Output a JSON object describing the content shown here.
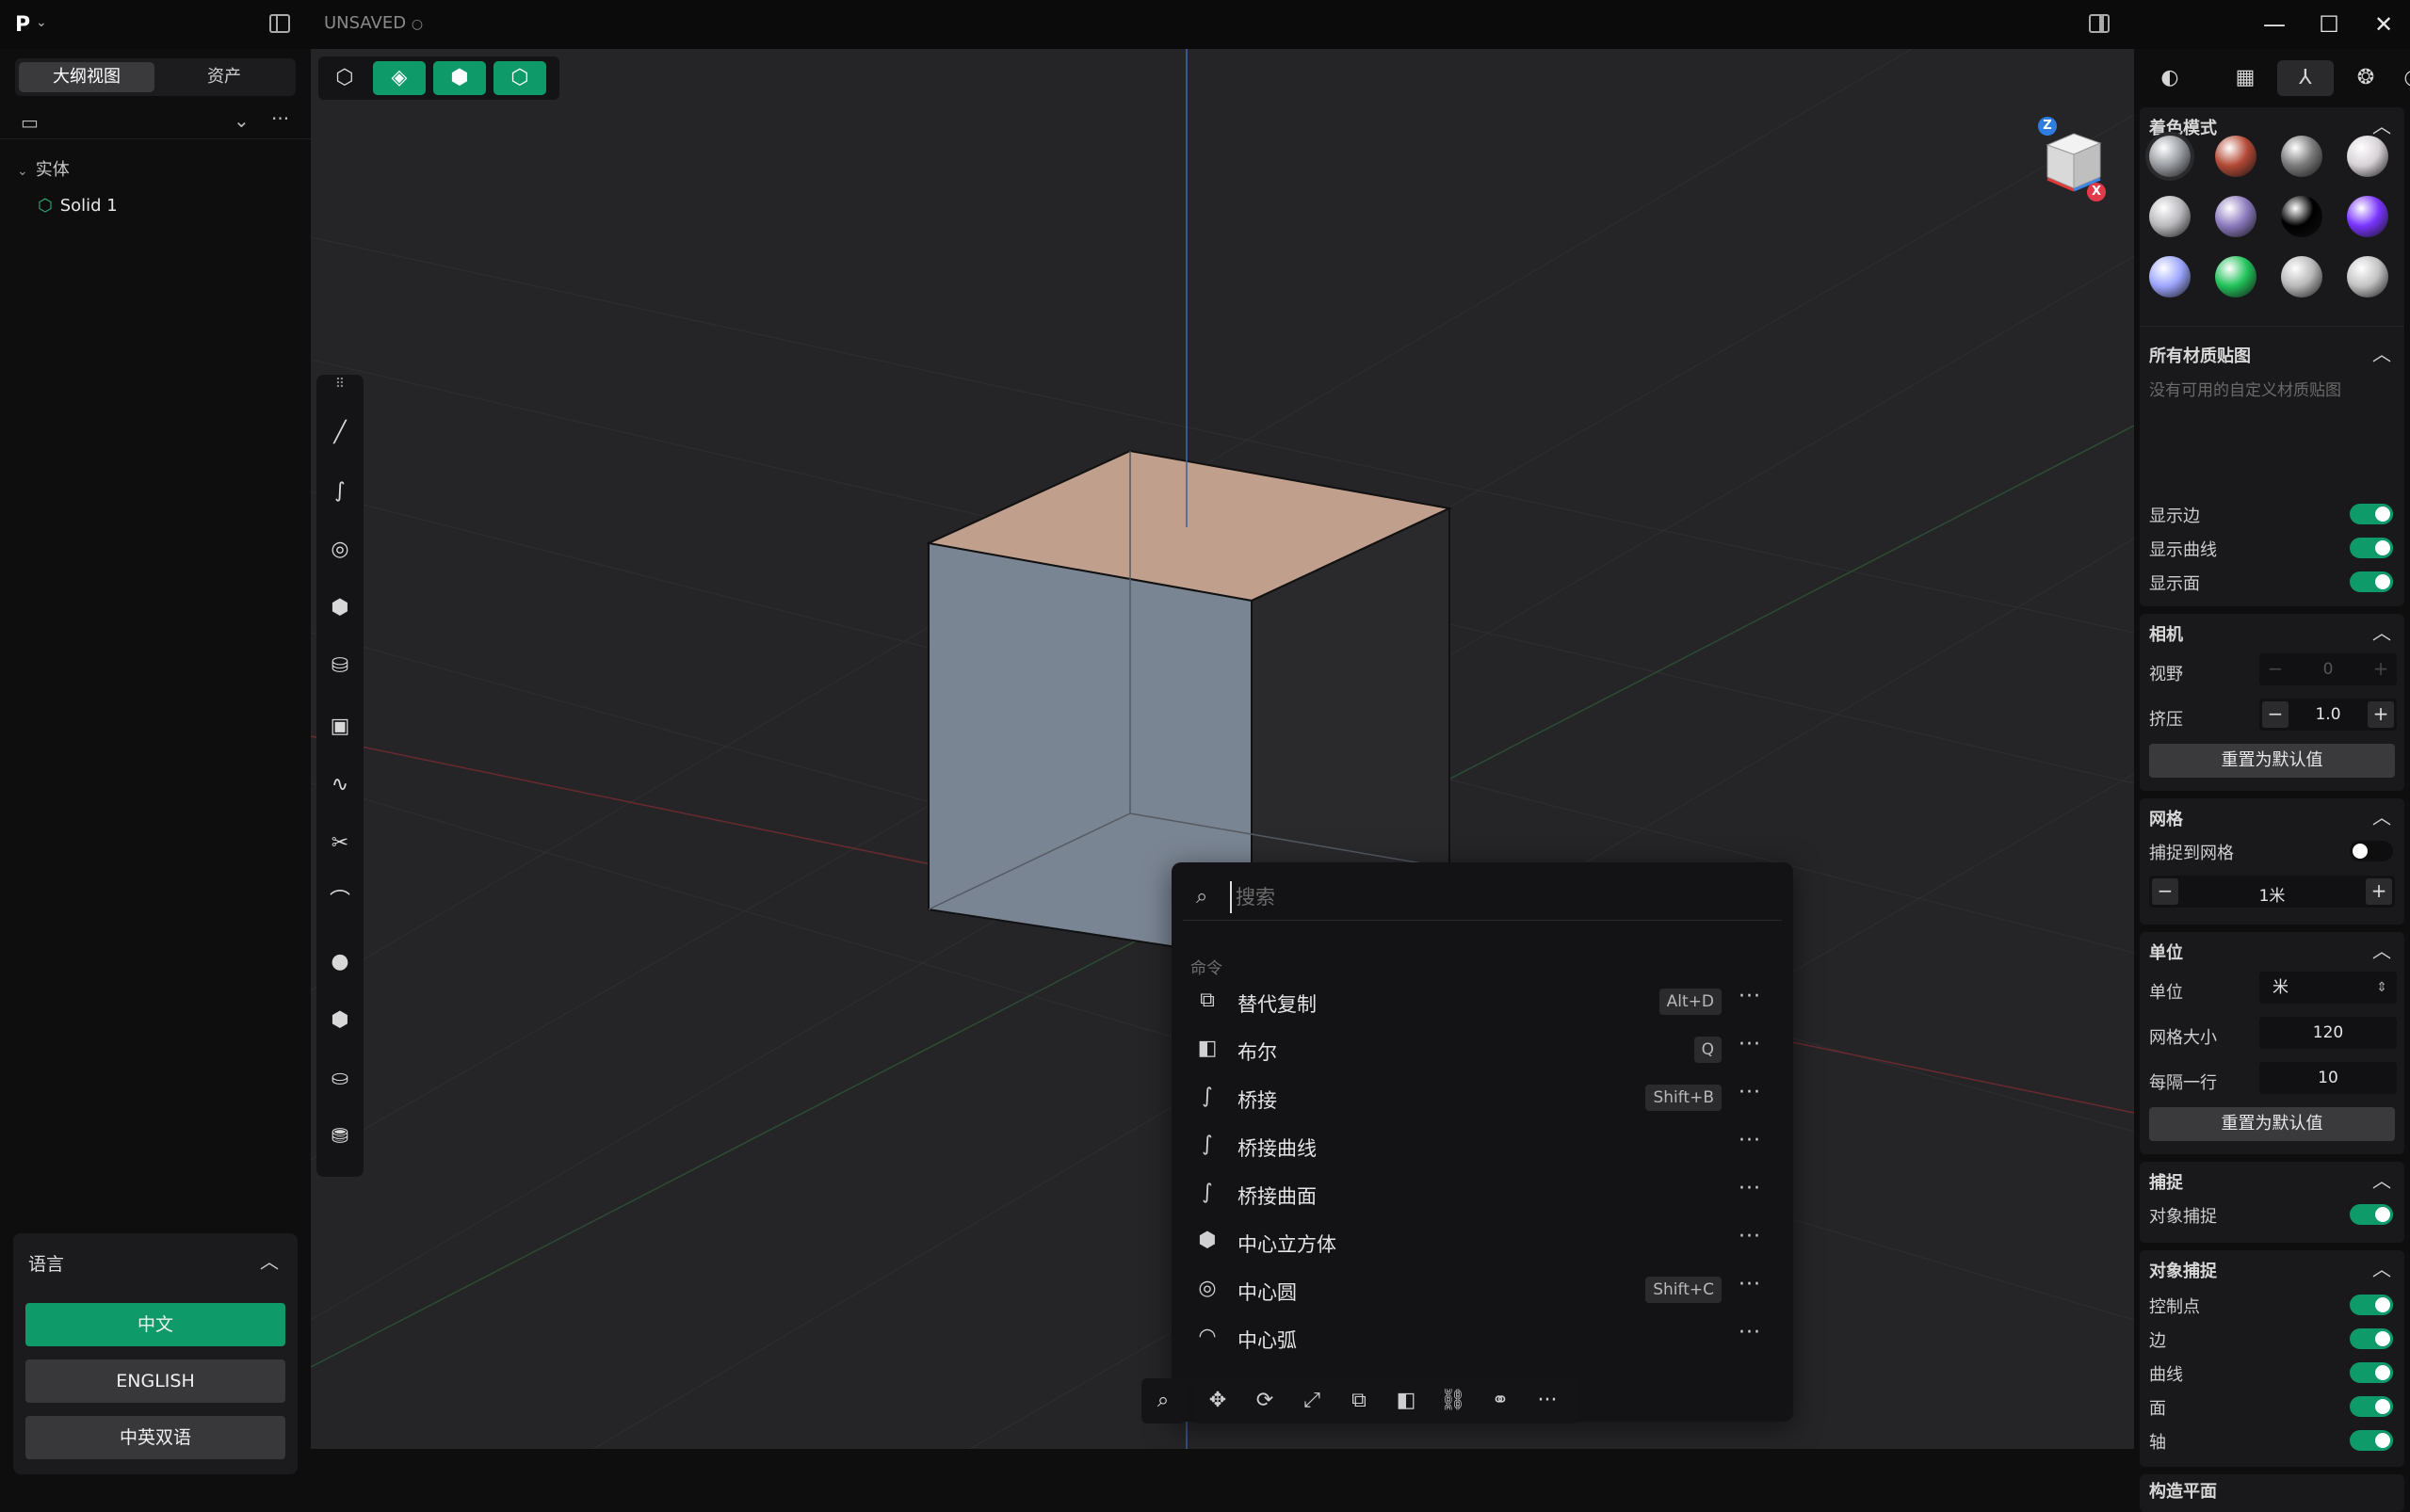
{
  "titlebar": {
    "logo": "P",
    "status": "UNSAVED",
    "window_controls": [
      "minimize",
      "maximize",
      "close"
    ]
  },
  "left_panel": {
    "tabs": [
      "大纲视图",
      "资产"
    ],
    "tree_group": "实体",
    "tree_item": "Solid 1",
    "language": {
      "title": "语言",
      "options": [
        "中文",
        "ENGLISH",
        "中英双语"
      ],
      "selected": "中文"
    }
  },
  "viewport": {
    "toolbar_icons": [
      "select-mode-icon",
      "vertex-mode-icon",
      "face-mode-icon",
      "object-mode-icon"
    ],
    "side_tools": [
      "line-icon",
      "curve-icon",
      "circle-icon",
      "polygon-icon",
      "extrude-icon",
      "rectangle-icon",
      "spline-icon",
      "scissors-icon",
      "fillet-icon",
      "sphere-icon",
      "box-icon",
      "cylinder-icon",
      "loft-icon"
    ],
    "viewcube_axes": {
      "z": "Z",
      "x": "X"
    }
  },
  "palette": {
    "search_placeholder": "搜索",
    "section": "命令",
    "commands": [
      {
        "label": "替代复制",
        "shortcut": "Alt+D",
        "icon": "duplicate-icon"
      },
      {
        "label": "布尔",
        "shortcut": "Q",
        "icon": "boolean-icon"
      },
      {
        "label": "桥接",
        "shortcut": "Shift+B",
        "icon": "bridge-icon"
      },
      {
        "label": "桥接曲线",
        "shortcut": "",
        "icon": "bridge-icon"
      },
      {
        "label": "桥接曲面",
        "shortcut": "",
        "icon": "bridge-icon"
      },
      {
        "label": "中心立方体",
        "shortcut": "",
        "icon": "cube-icon"
      },
      {
        "label": "中心圆",
        "shortcut": "Shift+C",
        "icon": "circle-icon"
      },
      {
        "label": "中心弧",
        "shortcut": "",
        "icon": "arc-icon"
      }
    ]
  },
  "right_panel": {
    "shading": {
      "title": "着色模式",
      "swatches": [
        "#9a9da3",
        "#b44a36",
        "#7a7a7a",
        "#d7d2d6",
        "#b9b9bd",
        "#8d7bbf",
        "#000000",
        "#7a35ff",
        "#9da6ff",
        "#22c25a",
        "#b8b8b8",
        "#c3c3c3"
      ]
    },
    "materials": {
      "title": "所有材质贴图",
      "empty": "没有可用的自定义材质贴图"
    },
    "display": [
      {
        "label": "显示边",
        "on": true
      },
      {
        "label": "显示曲线",
        "on": true
      },
      {
        "label": "显示面",
        "on": true
      }
    ],
    "camera": {
      "title": "相机",
      "fov_label": "视野",
      "fov_value": "0",
      "squash_label": "挤压",
      "squash_value": "1.0",
      "reset": "重置为默认值"
    },
    "grid": {
      "title": "网格",
      "snap_label": "捕捉到网格",
      "snap_on": false,
      "size_value": "1米"
    },
    "units": {
      "title": "单位",
      "unit_label": "单位",
      "unit_value": "米",
      "grid_size_label": "网格大小",
      "grid_size_value": "120",
      "every_label": "每隔一行",
      "every_value": "10",
      "reset": "重置为默认值"
    },
    "snap": {
      "title": "捕捉",
      "object_snap_label": "对象捕捉"
    },
    "object_snap": {
      "title": "对象捕捉",
      "items": [
        "控制点",
        "边",
        "曲线",
        "面",
        "轴"
      ]
    },
    "next_section": "构造平面"
  },
  "colors": {
    "accent": "#0f9a6a",
    "viewport_bg": "#252527",
    "box_top": "#c19f8d",
    "box_front": "#7a8593",
    "box_right": "#2a2a2c"
  }
}
